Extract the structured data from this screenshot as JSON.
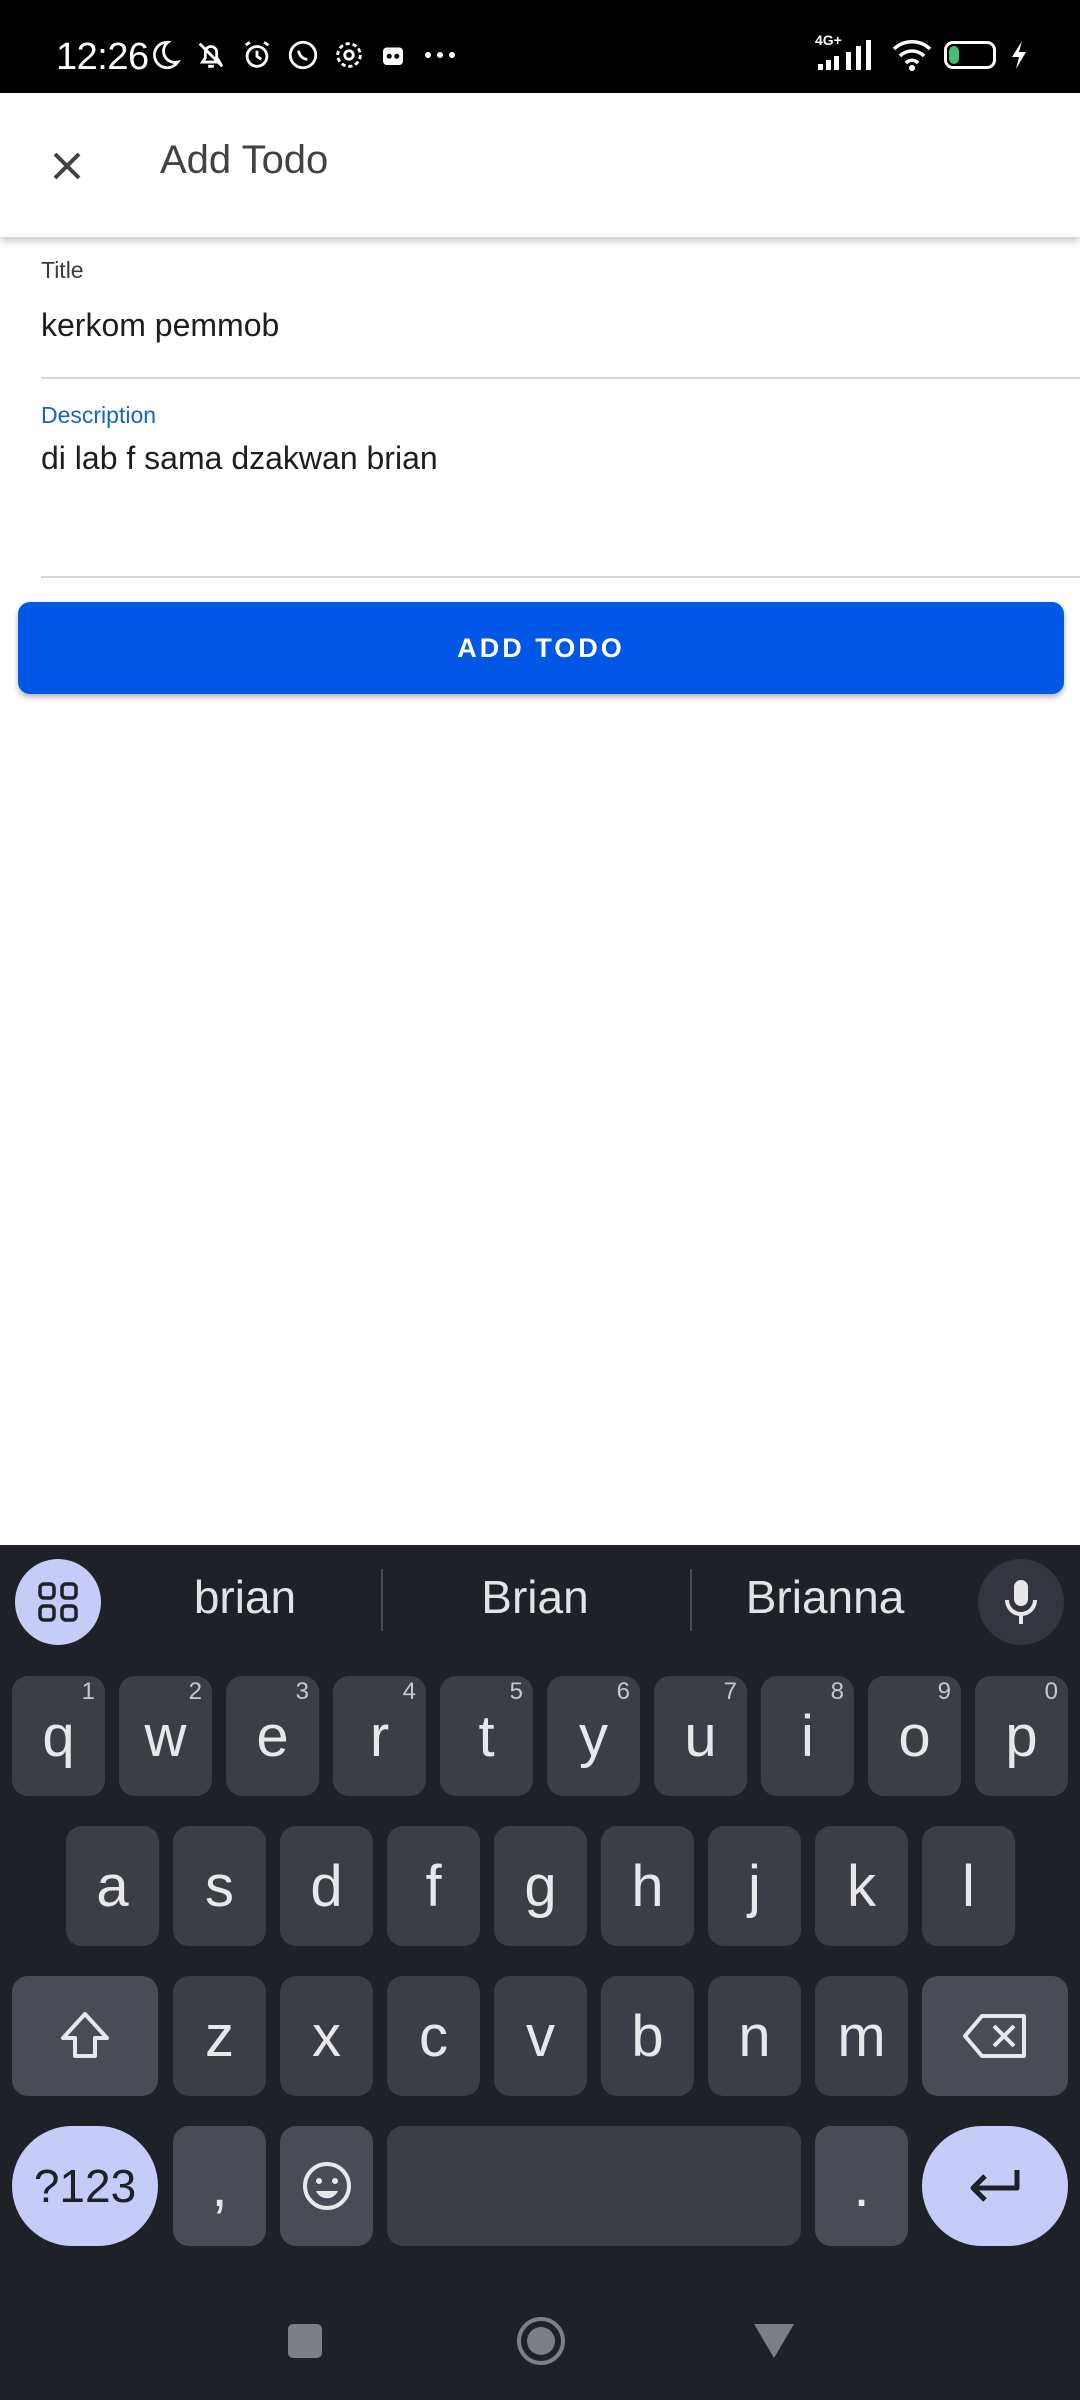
{
  "status_bar": {
    "time": "12:26",
    "network": "4G+",
    "battery": "31"
  },
  "app_bar": {
    "title": "Add Todo"
  },
  "form": {
    "title_label": "Title",
    "title_value": "kerkom pemmob",
    "description_label": "Description",
    "description_value": "di lab f sama dzakwan brian",
    "submit_label": "ADD TODO"
  },
  "keyboard": {
    "suggestions": [
      "brian",
      "Brian",
      "Brianna"
    ],
    "row1": [
      "q",
      "w",
      "e",
      "r",
      "t",
      "y",
      "u",
      "i",
      "o",
      "p"
    ],
    "row1_numbers": [
      "1",
      "2",
      "3",
      "4",
      "5",
      "6",
      "7",
      "8",
      "9",
      "0"
    ],
    "row2": [
      "a",
      "s",
      "d",
      "f",
      "g",
      "h",
      "j",
      "k",
      "l"
    ],
    "row3": [
      "z",
      "x",
      "c",
      "v",
      "b",
      "n",
      "m"
    ],
    "symbols_label": "?123",
    "comma": ",",
    "period": "."
  },
  "colors": {
    "accent": "#0257e7",
    "focused_label": "#1565c0",
    "keyboard_bg": "#1f2129",
    "keyboard_accent": "#c7cbf8"
  }
}
